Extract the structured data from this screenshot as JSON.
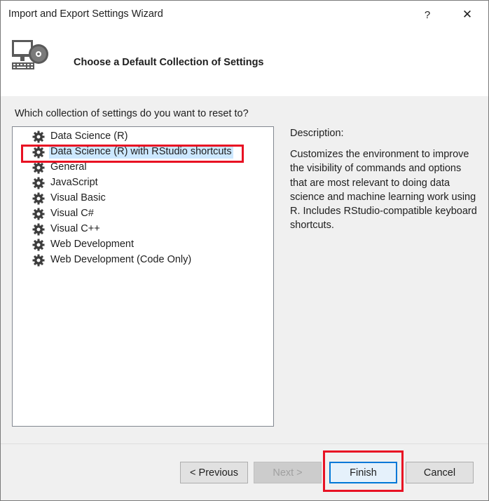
{
  "window": {
    "title": "Import and Export Settings Wizard",
    "help_label": "?",
    "close_label": "✕"
  },
  "header": {
    "title": "Choose a Default Collection of Settings",
    "icon": "settings-wizard-icon"
  },
  "content": {
    "prompt": "Which collection of settings do you want to reset to?",
    "items": [
      {
        "label": "Data Science (R)",
        "icon": "gear-icon",
        "selected": false
      },
      {
        "label": "Data Science (R) with RStudio shortcuts",
        "icon": "gear-icon",
        "selected": true
      },
      {
        "label": "General",
        "icon": "gear-icon",
        "selected": false
      },
      {
        "label": "JavaScript",
        "icon": "gear-icon",
        "selected": false
      },
      {
        "label": "Visual Basic",
        "icon": "gear-icon",
        "selected": false
      },
      {
        "label": "Visual C#",
        "icon": "gear-icon",
        "selected": false
      },
      {
        "label": "Visual C++",
        "icon": "gear-icon",
        "selected": false
      },
      {
        "label": "Web Development",
        "icon": "gear-icon",
        "selected": false
      },
      {
        "label": "Web Development (Code Only)",
        "icon": "gear-icon",
        "selected": false
      }
    ],
    "description_heading": "Description:",
    "description_text": "Customizes the environment to improve the visibility of commands and options that are most relevant to doing data science and machine learning work using R. Includes RStudio-compatible keyboard shortcuts."
  },
  "footer": {
    "previous_label": "< Previous",
    "next_label": "Next >",
    "finish_label": "Finish",
    "cancel_label": "Cancel"
  },
  "colors": {
    "highlight_annotation": "#e81123",
    "selection": "#cce8ff",
    "default_button_border": "#0078d7",
    "panel_background": "#f0f0f0"
  }
}
